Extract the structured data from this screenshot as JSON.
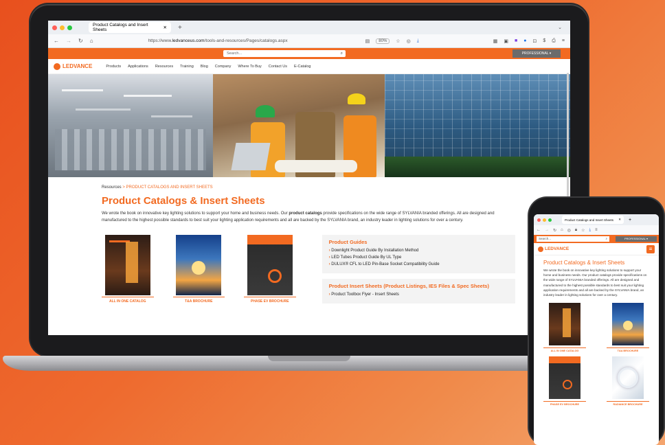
{
  "browser": {
    "tab_title": "Product Catalogs and Insert Sheets",
    "tab_close": "✕",
    "new_tab": "+",
    "url_prefix": "https://www.",
    "url_domain": "ledvanceus.com",
    "url_path": "/tools-and-resources/Pages/catalogs.aspx",
    "zoom": "80%"
  },
  "site": {
    "search_placeholder": "Search...",
    "professional_label": "PROFESSIONAL ▾",
    "logo_text": "LEDVANCE",
    "nav": [
      "Products",
      "Applications",
      "Resources",
      "Training",
      "Blog",
      "Company",
      "Where To Buy",
      "Contact Us",
      "E-Catalog"
    ]
  },
  "page": {
    "breadcrumb_root": "Resources",
    "breadcrumb_sep": ">",
    "breadcrumb_current": "PRODUCT CATALOGS AND INSERT SHEETS",
    "title": "Product Catalogs & Insert Sheets",
    "intro_1": "We wrote the book on innovative key lighting solutions to support your home and business needs. Our ",
    "intro_bold": "product catalogs",
    "intro_2": " provide specifications on the wide range of SYLVANIA branded offerings. All are designed and manufactured to the highest possible standards to best suit your lighting application requirements and all are backed by the SYLVANIA brand, an industry leader in lighting solutions for over a century.",
    "catalogs": [
      {
        "label": "ALL IN ONE CATALOG"
      },
      {
        "label": "T&A BROCHURE"
      },
      {
        "label": "PHASE EV BROCHURE"
      }
    ],
    "guides_title": "Product Guides",
    "guides": [
      "Downlight Product Guide By Installation Method",
      "LED Tubes Product Guide By UL Type",
      "DULUX® CFL to LED Pin-Base Socket Compatibility Guide"
    ],
    "insert_title": "Product Insert Sheets (Product Listings, IES Files & Spec Sheets)",
    "inserts": [
      "Product Toolbox Flyer - Insert Sheets"
    ]
  },
  "mobile": {
    "tab_title": "Product Catalogs and Insert Sheets",
    "search_placeholder": "Search...",
    "professional_label": "PROFESSIONAL ▾",
    "title": "Product Catalogs & Insert Sheets",
    "intro": "We wrote the book on innovative key lighting solutions to support your home and business needs. Our product catalogs provide specifications on the wide range of SYLVANIA branded offerings. All are designed and manufactured to the highest possible standards to best suit your lighting application requirements and all are backed by the SYLVANIA brand, an industry leader in lighting solutions for over a century.",
    "catalogs": [
      "ALL IN ONE CATALOG",
      "T&A BROCHURE",
      "PHASE EV BROCHURE",
      "RADIANCE BROCHURE"
    ],
    "menu_icon": "≡"
  },
  "colors": {
    "brand_orange": "#f26a21",
    "background_gradient_start": "#e8501e",
    "background_gradient_end": "#f4a56e"
  }
}
